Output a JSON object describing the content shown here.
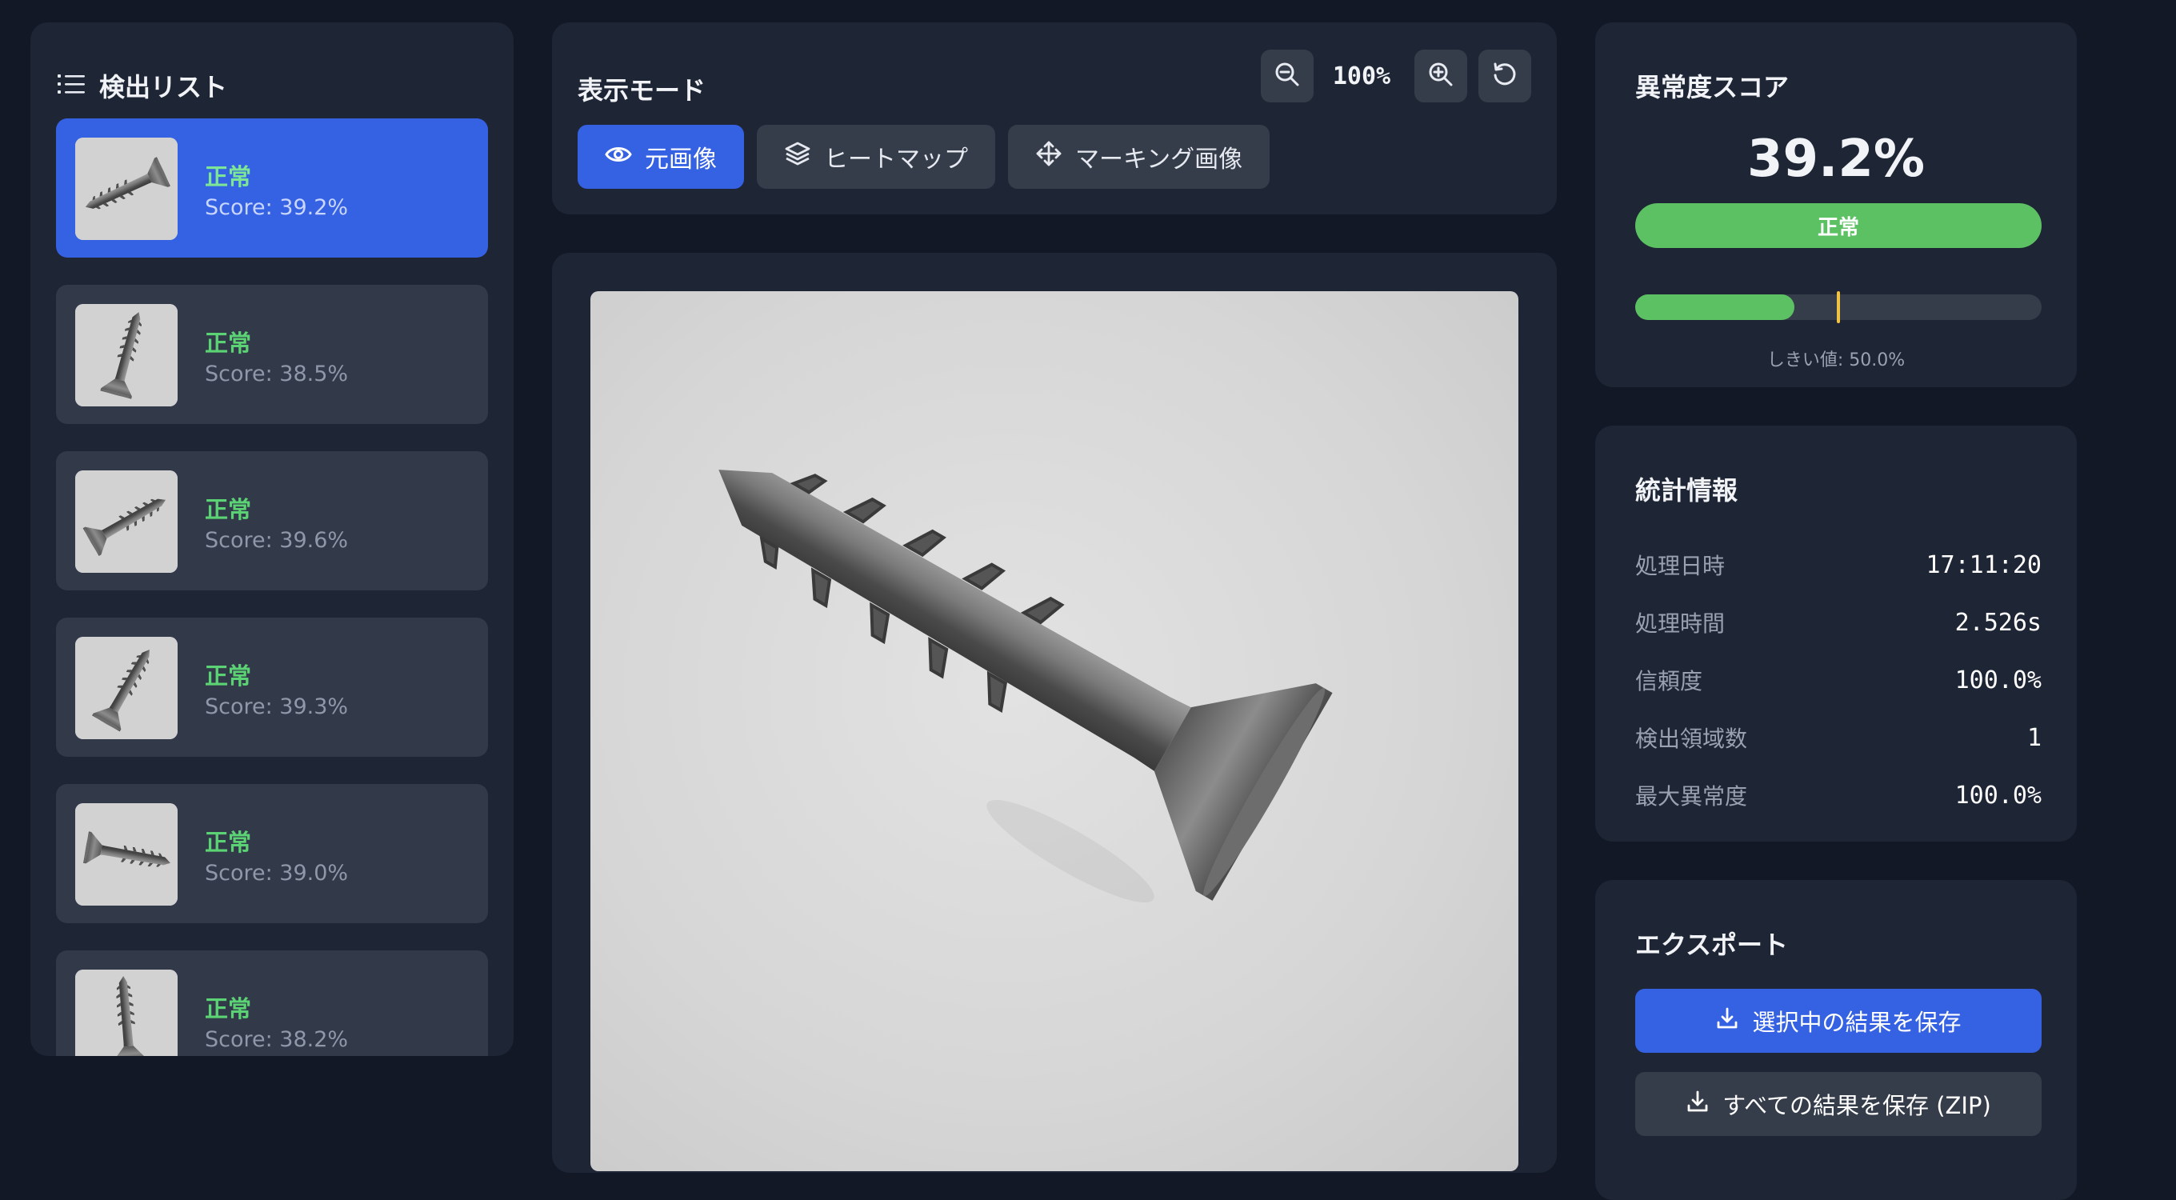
{
  "list": {
    "title": "検出リスト",
    "icon": "list-icon",
    "items": [
      {
        "status": "正常",
        "score": "Score: 39.2%",
        "angle": -25
      },
      {
        "status": "正常",
        "score": "Score: 38.5%",
        "angle": 105
      },
      {
        "status": "正常",
        "score": "Score: 39.6%",
        "angle": 150
      },
      {
        "status": "正常",
        "score": "Score: 39.3%",
        "angle": 120
      },
      {
        "status": "正常",
        "score": "Score: 39.0%",
        "angle": 190
      },
      {
        "status": "正常",
        "score": "Score: 38.2%",
        "angle": 85
      }
    ]
  },
  "view": {
    "title": "表示モード",
    "zoom": "100%",
    "tabs": [
      {
        "label": "元画像",
        "icon": "eye-icon"
      },
      {
        "label": "ヒートマップ",
        "icon": "layers-icon"
      },
      {
        "label": "マーキング画像",
        "icon": "move-icon"
      }
    ]
  },
  "score": {
    "title": "異常度スコア",
    "value": "39.2%",
    "status": "正常",
    "progress": 0.392,
    "threshold_fraction": 0.5,
    "threshold_label": "しきい値: 50.0%"
  },
  "stats": {
    "title": "統計情報",
    "rows": [
      {
        "label": "処理日時",
        "value": "17:11:20"
      },
      {
        "label": "処理時間",
        "value": "2.526s"
      },
      {
        "label": "信頼度",
        "value": "100.0%"
      },
      {
        "label": "検出領域数",
        "value": "1"
      },
      {
        "label": "最大異常度",
        "value": "100.0%"
      }
    ]
  },
  "export": {
    "title": "エクスポート",
    "save_selected": "選択中の結果を保存",
    "save_all": "すべての結果を保存 (ZIP)"
  },
  "colors": {
    "accent": "#3561e3",
    "normal": "#5cc163",
    "threshold": "#f2c243"
  }
}
